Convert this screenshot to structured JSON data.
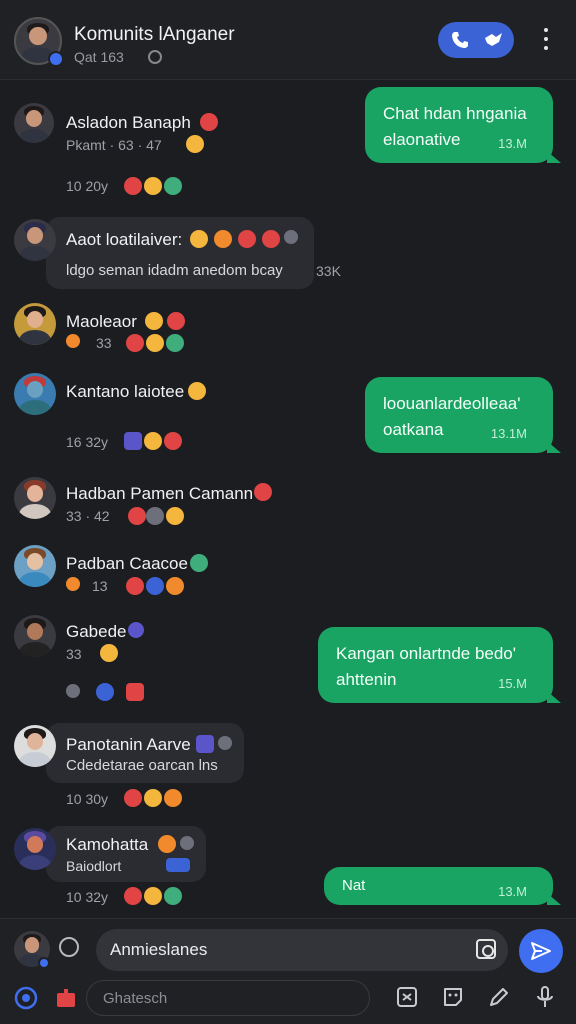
{
  "header": {
    "title": "Komunits lAnganer",
    "subtitle": "Qat 163"
  },
  "messages": [
    {
      "name": "Asladon Banaph",
      "meta": "Pkamt · 63 · 47",
      "time": "10 20y"
    },
    {
      "name": "Aaot loatilaiver:",
      "text": "ldgo seman idadm anedom bcay",
      "count": "33K"
    },
    {
      "name": "Maoleaor",
      "meta": "33",
      "time": ""
    },
    {
      "name": "Kantano laiotee",
      "time": "16 32y"
    },
    {
      "name": "Hadban Pamen Camann",
      "meta": "33 · 42"
    },
    {
      "name": "Padban Caacoe",
      "meta": "13"
    },
    {
      "name": "Gabede",
      "meta": "33"
    },
    {
      "name": "Panotanin Aarve",
      "text": "Cdedetarae oarcan lns",
      "time": "10 30y"
    },
    {
      "name": "Kamohatta",
      "text": "Baiodlort",
      "time": "10 32y"
    }
  ],
  "outgoing": [
    {
      "line1": "Chat hdan hngania",
      "line2": "elaonative",
      "time": "13.M"
    },
    {
      "line1": "loouanlardeolleaa'",
      "line2": "oatkana",
      "time": "13.1M"
    },
    {
      "line1": "Kangan onlartnde bedo'",
      "line2": "ahttenin",
      "time": "15.M"
    },
    {
      "line1": "Nat",
      "line2": "",
      "time": "13.M"
    }
  ],
  "composer": {
    "message_value": "Anmieslanes",
    "secondary_placeholder": "Ghatesch"
  },
  "colors": {
    "accent": "#3f6ff0",
    "outgoing": "#19a464",
    "background": "#1c1d21"
  }
}
